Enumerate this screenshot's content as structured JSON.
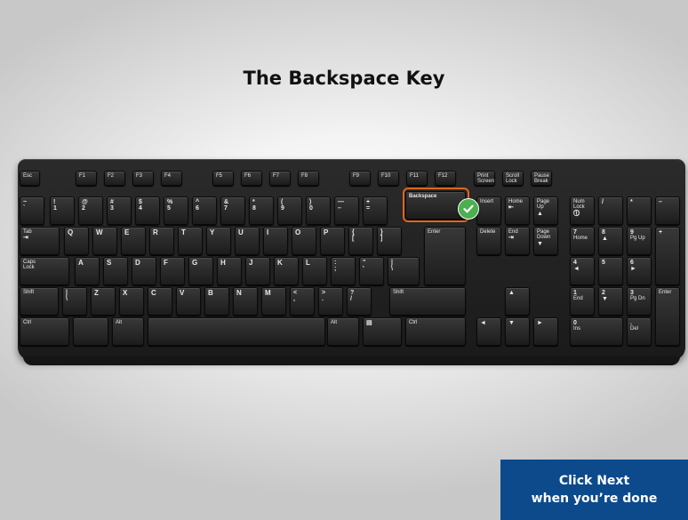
{
  "slide": {
    "title": "The Backspace Key",
    "next_line1": "Click Next",
    "next_line2": "when you’re done",
    "highlight_color": "#e1661c",
    "check_color": "#4caf50",
    "next_bg": "#0c4a8c"
  },
  "keyboard": {
    "keys": [
      {
        "id": "esc",
        "lines": [
          "Esc"
        ]
      },
      {
        "id": "f1",
        "lines": [
          "F1"
        ]
      },
      {
        "id": "f2",
        "lines": [
          "F2"
        ]
      },
      {
        "id": "f3",
        "lines": [
          "F3"
        ]
      },
      {
        "id": "f4",
        "lines": [
          "F4"
        ]
      },
      {
        "id": "f5",
        "lines": [
          "F5"
        ]
      },
      {
        "id": "f6",
        "lines": [
          "F6"
        ]
      },
      {
        "id": "f7",
        "lines": [
          "F7"
        ]
      },
      {
        "id": "f8",
        "lines": [
          "F8"
        ]
      },
      {
        "id": "f9",
        "lines": [
          "F9"
        ]
      },
      {
        "id": "f10",
        "lines": [
          "F10"
        ]
      },
      {
        "id": "f11",
        "lines": [
          "F11"
        ]
      },
      {
        "id": "f12",
        "lines": [
          "F12"
        ]
      },
      {
        "id": "prtsc",
        "lines": [
          "Print",
          "Screen"
        ]
      },
      {
        "id": "scrlk",
        "lines": [
          "Scroll",
          "Lock"
        ]
      },
      {
        "id": "pause",
        "lines": [
          "Pause",
          "Break"
        ]
      },
      {
        "id": "tilde",
        "lines": [
          "~",
          "`"
        ]
      },
      {
        "id": "1",
        "lines": [
          "!",
          "1"
        ]
      },
      {
        "id": "2",
        "lines": [
          "@",
          "2"
        ]
      },
      {
        "id": "3",
        "lines": [
          "#",
          "3"
        ]
      },
      {
        "id": "4",
        "lines": [
          "$",
          "4"
        ]
      },
      {
        "id": "5",
        "lines": [
          "%",
          "5"
        ]
      },
      {
        "id": "6",
        "lines": [
          "^",
          "6"
        ]
      },
      {
        "id": "7",
        "lines": [
          "&",
          "7"
        ]
      },
      {
        "id": "8",
        "lines": [
          "*",
          "8"
        ]
      },
      {
        "id": "9",
        "lines": [
          "(",
          "9"
        ]
      },
      {
        "id": "0",
        "lines": [
          ")",
          "0"
        ]
      },
      {
        "id": "minus",
        "lines": [
          "—",
          "–"
        ]
      },
      {
        "id": "equal",
        "lines": [
          "+",
          "="
        ]
      },
      {
        "id": "backspace",
        "lines": [
          "Backspace"
        ]
      },
      {
        "id": "insert",
        "lines": [
          "Insert"
        ]
      },
      {
        "id": "home",
        "lines": [
          "Home",
          "⇤"
        ]
      },
      {
        "id": "pgup",
        "lines": [
          "Page",
          "Up",
          "▲"
        ]
      },
      {
        "id": "numlk",
        "lines": [
          "Num",
          "Lock",
          "⓵"
        ]
      },
      {
        "id": "ndiv",
        "lines": [
          "/"
        ]
      },
      {
        "id": "nmul",
        "lines": [
          "*"
        ]
      },
      {
        "id": "nsub",
        "lines": [
          "–"
        ]
      },
      {
        "id": "tab",
        "lines": [
          "Tab",
          "⇥"
        ]
      },
      {
        "id": "q",
        "lines": [
          "Q"
        ]
      },
      {
        "id": "w",
        "lines": [
          "W"
        ]
      },
      {
        "id": "e",
        "lines": [
          "E"
        ]
      },
      {
        "id": "r",
        "lines": [
          "R"
        ]
      },
      {
        "id": "t",
        "lines": [
          "T"
        ]
      },
      {
        "id": "y",
        "lines": [
          "Y"
        ]
      },
      {
        "id": "u",
        "lines": [
          "U"
        ]
      },
      {
        "id": "i",
        "lines": [
          "I"
        ]
      },
      {
        "id": "o",
        "lines": [
          "O"
        ]
      },
      {
        "id": "p",
        "lines": [
          "P"
        ]
      },
      {
        "id": "lbrace",
        "lines": [
          "{",
          "["
        ]
      },
      {
        "id": "rbrace",
        "lines": [
          "}",
          "]"
        ]
      },
      {
        "id": "enter",
        "lines": [
          "Enter"
        ]
      },
      {
        "id": "delete",
        "lines": [
          "Delete"
        ]
      },
      {
        "id": "end",
        "lines": [
          "End",
          "⇥"
        ]
      },
      {
        "id": "pgdn",
        "lines": [
          "Page",
          "Down",
          "▼"
        ]
      },
      {
        "id": "n7",
        "lines": [
          "7",
          "Home"
        ]
      },
      {
        "id": "n8",
        "lines": [
          "8",
          "▲"
        ]
      },
      {
        "id": "n9",
        "lines": [
          "9",
          "Pg Up"
        ]
      },
      {
        "id": "nadd",
        "lines": [
          "+"
        ]
      },
      {
        "id": "caps",
        "lines": [
          "Caps",
          "Lock"
        ]
      },
      {
        "id": "a",
        "lines": [
          "A"
        ]
      },
      {
        "id": "s",
        "lines": [
          "S"
        ]
      },
      {
        "id": "d",
        "lines": [
          "D"
        ]
      },
      {
        "id": "f",
        "lines": [
          "F"
        ]
      },
      {
        "id": "g",
        "lines": [
          "G"
        ]
      },
      {
        "id": "h",
        "lines": [
          "H"
        ]
      },
      {
        "id": "j",
        "lines": [
          "J"
        ]
      },
      {
        "id": "k",
        "lines": [
          "K"
        ]
      },
      {
        "id": "l",
        "lines": [
          "L"
        ]
      },
      {
        "id": "semi",
        "lines": [
          ":",
          ";"
        ]
      },
      {
        "id": "quote",
        "lines": [
          "\"",
          "'"
        ]
      },
      {
        "id": "bslash",
        "lines": [
          "|",
          "\\"
        ]
      },
      {
        "id": "n4",
        "lines": [
          "4",
          "◄"
        ]
      },
      {
        "id": "n5",
        "lines": [
          "5"
        ]
      },
      {
        "id": "n6",
        "lines": [
          "6",
          "►"
        ]
      },
      {
        "id": "lshift",
        "lines": [
          "Shift"
        ]
      },
      {
        "id": "oem102",
        "lines": [
          "|",
          "\\"
        ]
      },
      {
        "id": "z",
        "lines": [
          "Z"
        ]
      },
      {
        "id": "x",
        "lines": [
          "X"
        ]
      },
      {
        "id": "c",
        "lines": [
          "C"
        ]
      },
      {
        "id": "v",
        "lines": [
          "V"
        ]
      },
      {
        "id": "b",
        "lines": [
          "B"
        ]
      },
      {
        "id": "n",
        "lines": [
          "N"
        ]
      },
      {
        "id": "m",
        "lines": [
          "M"
        ]
      },
      {
        "id": "comma",
        "lines": [
          "<",
          ","
        ]
      },
      {
        "id": "period",
        "lines": [
          ">",
          "."
        ]
      },
      {
        "id": "slash",
        "lines": [
          "?",
          "/"
        ]
      },
      {
        "id": "rshift",
        "lines": [
          "Shift"
        ]
      },
      {
        "id": "up",
        "lines": [
          "▲"
        ]
      },
      {
        "id": "n1",
        "lines": [
          "1",
          "End"
        ]
      },
      {
        "id": "n2",
        "lines": [
          "2",
          "▼"
        ]
      },
      {
        "id": "n3",
        "lines": [
          "3",
          "Pg Dn"
        ]
      },
      {
        "id": "nenter",
        "lines": [
          "Enter"
        ]
      },
      {
        "id": "lctrl",
        "lines": [
          "Ctrl"
        ]
      },
      {
        "id": "lwin",
        "lines": [
          ""
        ]
      },
      {
        "id": "lalt",
        "lines": [
          "Alt"
        ]
      },
      {
        "id": "space",
        "lines": [
          ""
        ]
      },
      {
        "id": "ralt",
        "lines": [
          "Alt"
        ]
      },
      {
        "id": "menu",
        "lines": [
          "▤"
        ]
      },
      {
        "id": "rctrl",
        "lines": [
          "Ctrl"
        ]
      },
      {
        "id": "left",
        "lines": [
          "◄"
        ]
      },
      {
        "id": "down",
        "lines": [
          "▼"
        ]
      },
      {
        "id": "right",
        "lines": [
          "►"
        ]
      },
      {
        "id": "n0",
        "lines": [
          "0",
          "Ins"
        ]
      },
      {
        "id": "ndot",
        "lines": [
          ".",
          "Del"
        ]
      }
    ]
  }
}
